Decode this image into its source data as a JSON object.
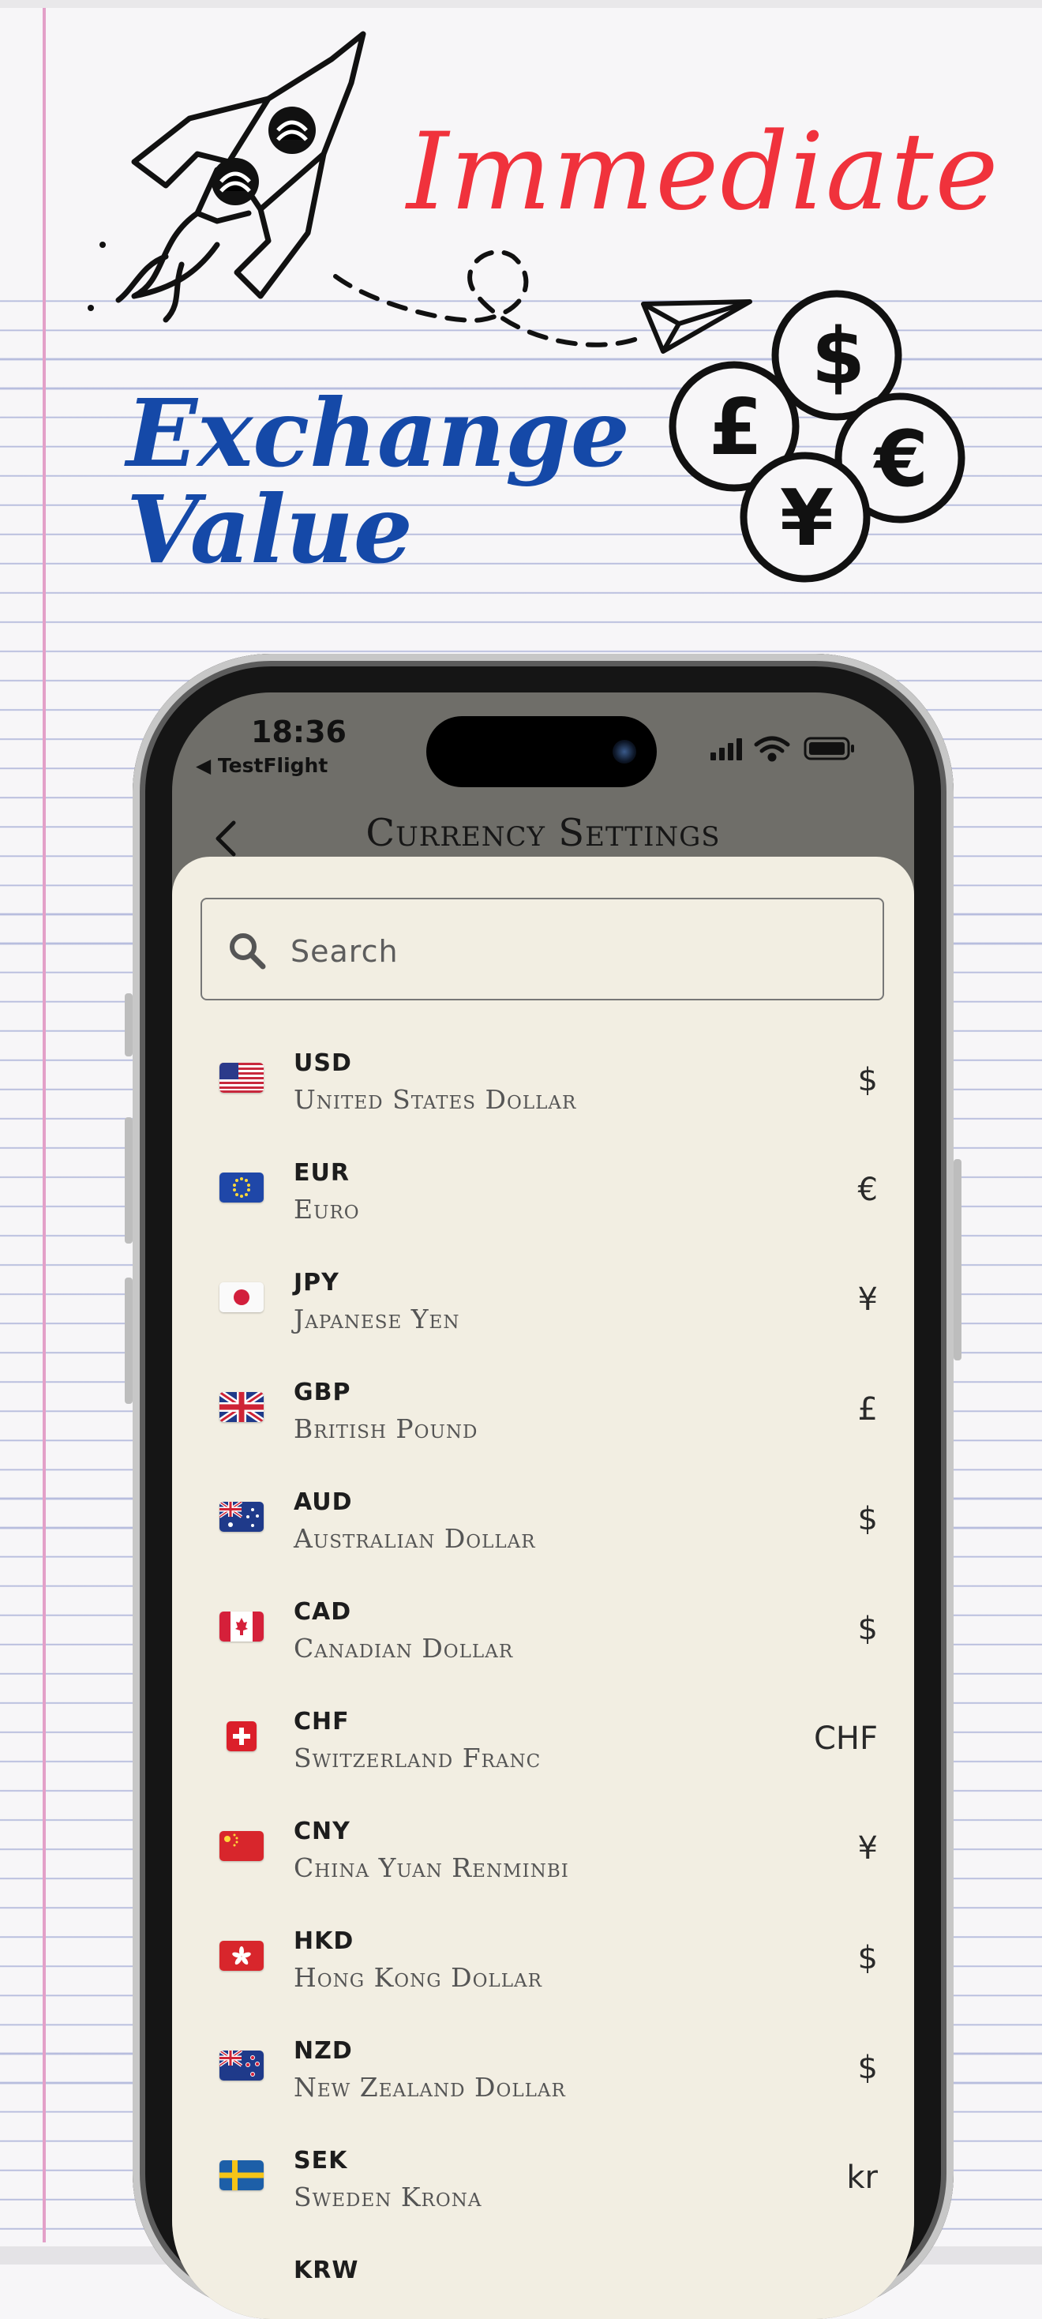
{
  "headline": {
    "line1": "Immediate",
    "line2a": "Exchange",
    "line2b": "Value"
  },
  "status_bar": {
    "time": "18:36",
    "back_app": "◀ TestFlight"
  },
  "nav": {
    "back_icon": "chevron-left-icon",
    "title": "Currency Settings"
  },
  "search": {
    "placeholder": "Search",
    "icon": "search-icon"
  },
  "currencies": [
    {
      "code": "USD",
      "name": "United States Dollar",
      "symbol": "$"
    },
    {
      "code": "EUR",
      "name": "Euro",
      "symbol": "€"
    },
    {
      "code": "JPY",
      "name": "Japanese Yen",
      "symbol": "¥"
    },
    {
      "code": "GBP",
      "name": "British Pound",
      "symbol": "£"
    },
    {
      "code": "AUD",
      "name": "Australian Dollar",
      "symbol": "$"
    },
    {
      "code": "CAD",
      "name": "Canadian Dollar",
      "symbol": "$"
    },
    {
      "code": "CHF",
      "name": "Switzerland Franc",
      "symbol": "CHF"
    },
    {
      "code": "CNY",
      "name": "China Yuan Renminbi",
      "symbol": "¥"
    },
    {
      "code": "HKD",
      "name": "Hong Kong Dollar",
      "symbol": "$"
    },
    {
      "code": "NZD",
      "name": "New Zealand Dollar",
      "symbol": "$"
    },
    {
      "code": "SEK",
      "name": "Sweden Krona",
      "symbol": "kr"
    },
    {
      "code": "KRW",
      "name": "",
      "symbol": ""
    }
  ],
  "colors": {
    "headline_red": "#f0323c",
    "headline_blue": "#1549a8",
    "sheet_bg": "#f2eee2"
  }
}
